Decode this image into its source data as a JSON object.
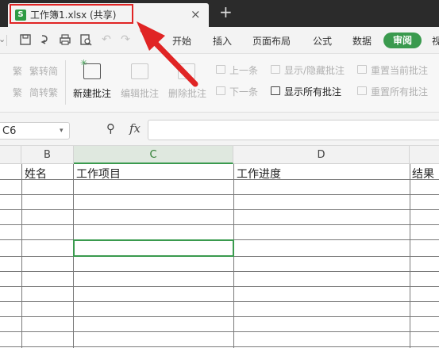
{
  "titlebar": {
    "tab_icon": "S",
    "tab_title": "工作簿1.xlsx (共享)",
    "tab_close": "×",
    "new_tab": "+",
    "highlight_color": "#e02424"
  },
  "menubar": {
    "items": [
      "开始",
      "插入",
      "页面布局",
      "公式",
      "数据",
      "审阅",
      "视"
    ],
    "active": "审阅",
    "accent_color": "#3a9a4e"
  },
  "ribbon": {
    "convert": [
      "繁转简",
      "简转繁"
    ],
    "new_comment": "新建批注",
    "edit_comment": "编辑批注",
    "delete_comment": "删除批注",
    "prev": "上一条",
    "next": "下一条",
    "show_hide": "显示/隐藏批注",
    "show_all": "显示所有批注",
    "reset_current": "重置当前批注",
    "reset_all": "重置所有批注"
  },
  "formula": {
    "cell_ref": "C6",
    "fx": "fx",
    "value": ""
  },
  "columns": [
    "B",
    "C",
    "D"
  ],
  "selected_column": "C",
  "headers": [
    "姓名",
    "工作项目",
    "工作进度",
    "结果"
  ]
}
